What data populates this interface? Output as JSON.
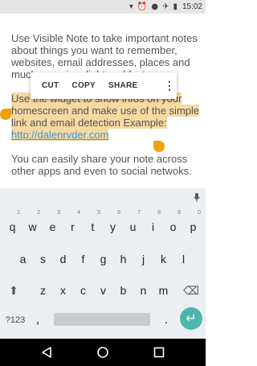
{
  "status_bar": {
    "time": "15:02",
    "icons": [
      "signal-icon",
      "alarm-icon",
      "notification-dot",
      "airplane-icon",
      "battery-icon"
    ]
  },
  "note": {
    "paragraph1": "Use Visible Note to take important notes about things you want to remember, websites, email addresses, places and much more in a light and fast way.",
    "paragraph2_text": "Use the widget to show infos on your homescreen and make use of the simple link and email detection Example: ",
    "paragraph2_link": "http://dalenryder.com",
    "paragraph3": "You can easily share your note across other apps and even to social netwoks."
  },
  "selection_toolbar": {
    "cut": "CUT",
    "copy": "COPY",
    "share": "SHARE",
    "more_icon": "more-vert-icon"
  },
  "keyboard": {
    "row1": [
      "q",
      "w",
      "e",
      "r",
      "t",
      "y",
      "u",
      "i",
      "o",
      "p"
    ],
    "row1_hints": [
      "1",
      "2",
      "3",
      "4",
      "5",
      "6",
      "7",
      "8",
      "9",
      "0"
    ],
    "row2": [
      "a",
      "s",
      "d",
      "f",
      "g",
      "h",
      "j",
      "k",
      "l"
    ],
    "row3": [
      "z",
      "x",
      "c",
      "v",
      "b",
      "n",
      "m"
    ],
    "symbols": "?123",
    "comma": ",",
    "period": ".",
    "enter_icon": "enter-arrow-icon",
    "shift_icon": "shift-icon",
    "backspace_icon": "backspace-icon"
  },
  "nav_bar": {
    "back": "back-icon",
    "home": "home-icon",
    "recents": "recents-icon"
  },
  "colors": {
    "selection": "#f5d9a1",
    "handle": "#f0a20a",
    "link": "#3a9ad9",
    "enter": "#4db6ac",
    "keyboard_bg": "#eceff1"
  }
}
